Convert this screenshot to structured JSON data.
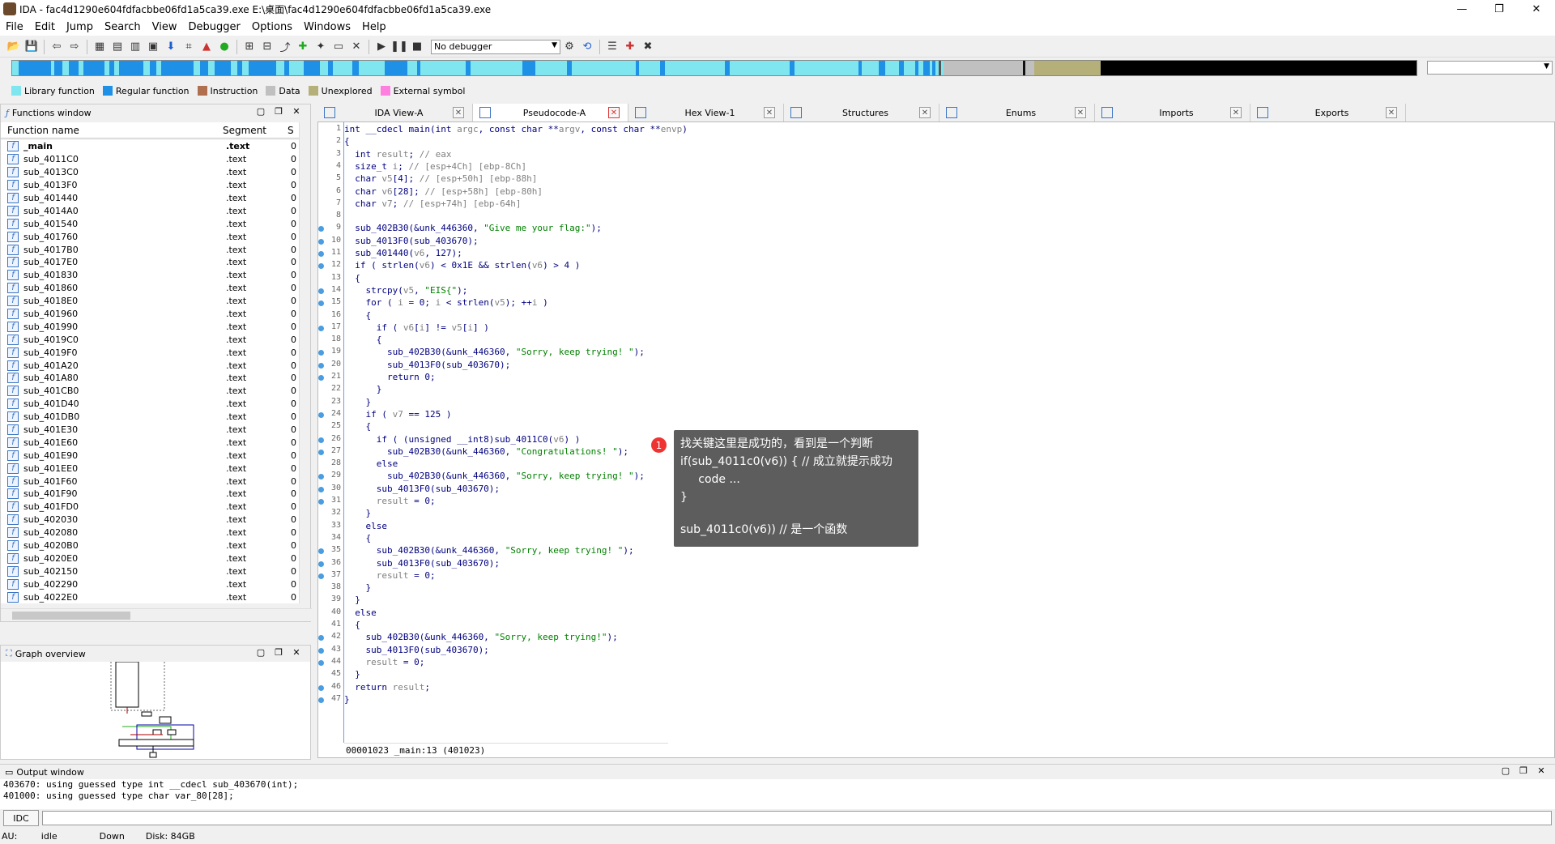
{
  "window": {
    "title": "IDA - fac4d1290e604fdfacbbe06fd1a5ca39.exe E:\\桌面\\fac4d1290e604fdfacbbe06fd1a5ca39.exe",
    "minimize": "—",
    "maximize": "❐",
    "close": "✕"
  },
  "menu": [
    "File",
    "Edit",
    "Jump",
    "Search",
    "View",
    "Debugger",
    "Options",
    "Windows",
    "Help"
  ],
  "toolbar": {
    "debugger_select": "No debugger"
  },
  "legend": [
    {
      "label": "Library function",
      "color": "#7fe6f0"
    },
    {
      "label": "Regular function",
      "color": "#1e90e6"
    },
    {
      "label": "Instruction",
      "color": "#b07050"
    },
    {
      "label": "Data",
      "color": "#c0c0c0"
    },
    {
      "label": "Unexplored",
      "color": "#b5b07a"
    },
    {
      "label": "External symbol",
      "color": "#ff7fe0"
    }
  ],
  "functions_window": {
    "title": "Functions window",
    "col_name": "Function name",
    "col_segment": "Segment",
    "col_s": "S",
    "rows": [
      {
        "name": "_main",
        "seg": ".text",
        "s": "0",
        "bold": true
      },
      {
        "name": "sub_4011C0",
        "seg": ".text",
        "s": "0"
      },
      {
        "name": "sub_4013C0",
        "seg": ".text",
        "s": "0"
      },
      {
        "name": "sub_4013F0",
        "seg": ".text",
        "s": "0"
      },
      {
        "name": "sub_401440",
        "seg": ".text",
        "s": "0"
      },
      {
        "name": "sub_4014A0",
        "seg": ".text",
        "s": "0"
      },
      {
        "name": "sub_401540",
        "seg": ".text",
        "s": "0"
      },
      {
        "name": "sub_401760",
        "seg": ".text",
        "s": "0"
      },
      {
        "name": "sub_4017B0",
        "seg": ".text",
        "s": "0"
      },
      {
        "name": "sub_4017E0",
        "seg": ".text",
        "s": "0"
      },
      {
        "name": "sub_401830",
        "seg": ".text",
        "s": "0"
      },
      {
        "name": "sub_401860",
        "seg": ".text",
        "s": "0"
      },
      {
        "name": "sub_4018E0",
        "seg": ".text",
        "s": "0"
      },
      {
        "name": "sub_401960",
        "seg": ".text",
        "s": "0"
      },
      {
        "name": "sub_401990",
        "seg": ".text",
        "s": "0"
      },
      {
        "name": "sub_4019C0",
        "seg": ".text",
        "s": "0"
      },
      {
        "name": "sub_4019F0",
        "seg": ".text",
        "s": "0"
      },
      {
        "name": "sub_401A20",
        "seg": ".text",
        "s": "0"
      },
      {
        "name": "sub_401A80",
        "seg": ".text",
        "s": "0"
      },
      {
        "name": "sub_401CB0",
        "seg": ".text",
        "s": "0"
      },
      {
        "name": "sub_401D40",
        "seg": ".text",
        "s": "0"
      },
      {
        "name": "sub_401DB0",
        "seg": ".text",
        "s": "0"
      },
      {
        "name": "sub_401E30",
        "seg": ".text",
        "s": "0"
      },
      {
        "name": "sub_401E60",
        "seg": ".text",
        "s": "0"
      },
      {
        "name": "sub_401E90",
        "seg": ".text",
        "s": "0"
      },
      {
        "name": "sub_401EE0",
        "seg": ".text",
        "s": "0"
      },
      {
        "name": "sub_401F60",
        "seg": ".text",
        "s": "0"
      },
      {
        "name": "sub_401F90",
        "seg": ".text",
        "s": "0"
      },
      {
        "name": "sub_401FD0",
        "seg": ".text",
        "s": "0"
      },
      {
        "name": "sub_402030",
        "seg": ".text",
        "s": "0"
      },
      {
        "name": "sub_402080",
        "seg": ".text",
        "s": "0"
      },
      {
        "name": "sub_4020B0",
        "seg": ".text",
        "s": "0"
      },
      {
        "name": "sub_4020E0",
        "seg": ".text",
        "s": "0"
      },
      {
        "name": "sub_402150",
        "seg": ".text",
        "s": "0"
      },
      {
        "name": "sub_402290",
        "seg": ".text",
        "s": "0"
      },
      {
        "name": "sub_4022E0",
        "seg": ".text",
        "s": "0"
      }
    ]
  },
  "graph_overview": {
    "title": "Graph overview"
  },
  "tabs": [
    {
      "label": "IDA View-A",
      "active": false
    },
    {
      "label": "Pseudocode-A",
      "active": true
    },
    {
      "label": "Hex View-1",
      "active": false
    },
    {
      "label": "Structures",
      "active": false
    },
    {
      "label": "Enums",
      "active": false
    },
    {
      "label": "Imports",
      "active": false
    },
    {
      "label": "Exports",
      "active": false
    }
  ],
  "code": {
    "lines": [
      {
        "n": "1",
        "dot": false,
        "t": "int __cdecl main(int argc, const char **argv, const char **envp)"
      },
      {
        "n": "2",
        "dot": false,
        "t": "{"
      },
      {
        "n": "3",
        "dot": false,
        "t": "  int result; // eax"
      },
      {
        "n": "4",
        "dot": false,
        "t": "  size_t i; // [esp+4Ch] [ebp-8Ch]"
      },
      {
        "n": "5",
        "dot": false,
        "t": "  char v5[4]; // [esp+50h] [ebp-88h]"
      },
      {
        "n": "6",
        "dot": false,
        "t": "  char v6[28]; // [esp+58h] [ebp-80h]"
      },
      {
        "n": "7",
        "dot": false,
        "t": "  char v7; // [esp+74h] [ebp-64h]"
      },
      {
        "n": "8",
        "dot": false,
        "t": ""
      },
      {
        "n": "9",
        "dot": true,
        "t": "  sub_402B30(&unk_446360, \"Give me your flag:\");"
      },
      {
        "n": "10",
        "dot": true,
        "t": "  sub_4013F0(sub_403670);"
      },
      {
        "n": "11",
        "dot": true,
        "t": "  sub_401440(v6, 127);"
      },
      {
        "n": "12",
        "dot": true,
        "t": "  if ( strlen(v6) < 0x1E && strlen(v6) > 4 )"
      },
      {
        "n": "13",
        "dot": false,
        "t": "  {"
      },
      {
        "n": "14",
        "dot": true,
        "t": "    strcpy(v5, \"EIS{\");"
      },
      {
        "n": "15",
        "dot": true,
        "t": "    for ( i = 0; i < strlen(v5); ++i )"
      },
      {
        "n": "16",
        "dot": false,
        "t": "    {"
      },
      {
        "n": "17",
        "dot": true,
        "t": "      if ( v6[i] != v5[i] )"
      },
      {
        "n": "18",
        "dot": false,
        "t": "      {"
      },
      {
        "n": "19",
        "dot": true,
        "t": "        sub_402B30(&unk_446360, \"Sorry, keep trying! \");"
      },
      {
        "n": "20",
        "dot": true,
        "t": "        sub_4013F0(sub_403670);"
      },
      {
        "n": "21",
        "dot": true,
        "t": "        return 0;"
      },
      {
        "n": "22",
        "dot": false,
        "t": "      }"
      },
      {
        "n": "23",
        "dot": false,
        "t": "    }"
      },
      {
        "n": "24",
        "dot": true,
        "t": "    if ( v7 == 125 )"
      },
      {
        "n": "25",
        "dot": false,
        "t": "    {"
      },
      {
        "n": "26",
        "dot": true,
        "t": "      if ( (unsigned __int8)sub_4011C0(v6) )"
      },
      {
        "n": "27",
        "dot": true,
        "t": "        sub_402B30(&unk_446360, \"Congratulations! \");"
      },
      {
        "n": "28",
        "dot": false,
        "t": "      else"
      },
      {
        "n": "29",
        "dot": true,
        "t": "        sub_402B30(&unk_446360, \"Sorry, keep trying! \");"
      },
      {
        "n": "30",
        "dot": true,
        "t": "      sub_4013F0(sub_403670);"
      },
      {
        "n": "31",
        "dot": true,
        "t": "      result = 0;"
      },
      {
        "n": "32",
        "dot": false,
        "t": "    }"
      },
      {
        "n": "33",
        "dot": false,
        "t": "    else"
      },
      {
        "n": "34",
        "dot": false,
        "t": "    {"
      },
      {
        "n": "35",
        "dot": true,
        "t": "      sub_402B30(&unk_446360, \"Sorry, keep trying! \");"
      },
      {
        "n": "36",
        "dot": true,
        "t": "      sub_4013F0(sub_403670);"
      },
      {
        "n": "37",
        "dot": true,
        "t": "      result = 0;"
      },
      {
        "n": "38",
        "dot": false,
        "t": "    }"
      },
      {
        "n": "39",
        "dot": false,
        "t": "  }"
      },
      {
        "n": "40",
        "dot": false,
        "t": "  else"
      },
      {
        "n": "41",
        "dot": false,
        "t": "  {"
      },
      {
        "n": "42",
        "dot": true,
        "t": "    sub_402B30(&unk_446360, \"Sorry, keep trying!\");"
      },
      {
        "n": "43",
        "dot": true,
        "t": "    sub_4013F0(sub_403670);"
      },
      {
        "n": "44",
        "dot": true,
        "t": "    result = 0;"
      },
      {
        "n": "45",
        "dot": false,
        "t": "  }"
      },
      {
        "n": "46",
        "dot": true,
        "t": "  return result;"
      },
      {
        "n": "47",
        "dot": true,
        "t": "}"
      }
    ],
    "status": "00001023 _main:13 (401023)"
  },
  "tooltip": {
    "badge": "1",
    "lines": [
      "找关键这里是成功的，看到是一个判断",
      "if(sub_4011c0(v6)) { // 成立就提示成功",
      "     code ...",
      "}",
      "",
      "sub_4011c0(v6)) // 是一个函数"
    ]
  },
  "output": {
    "title": "Output window",
    "lines": [
      "403670: using guessed type int __cdecl sub_403670(int);",
      "401000: using guessed type char var_80[28];"
    ]
  },
  "idc_button": "IDC",
  "status": {
    "au": "AU:",
    "state": "idle",
    "dir": "Down",
    "disk": "Disk: 84GB"
  }
}
